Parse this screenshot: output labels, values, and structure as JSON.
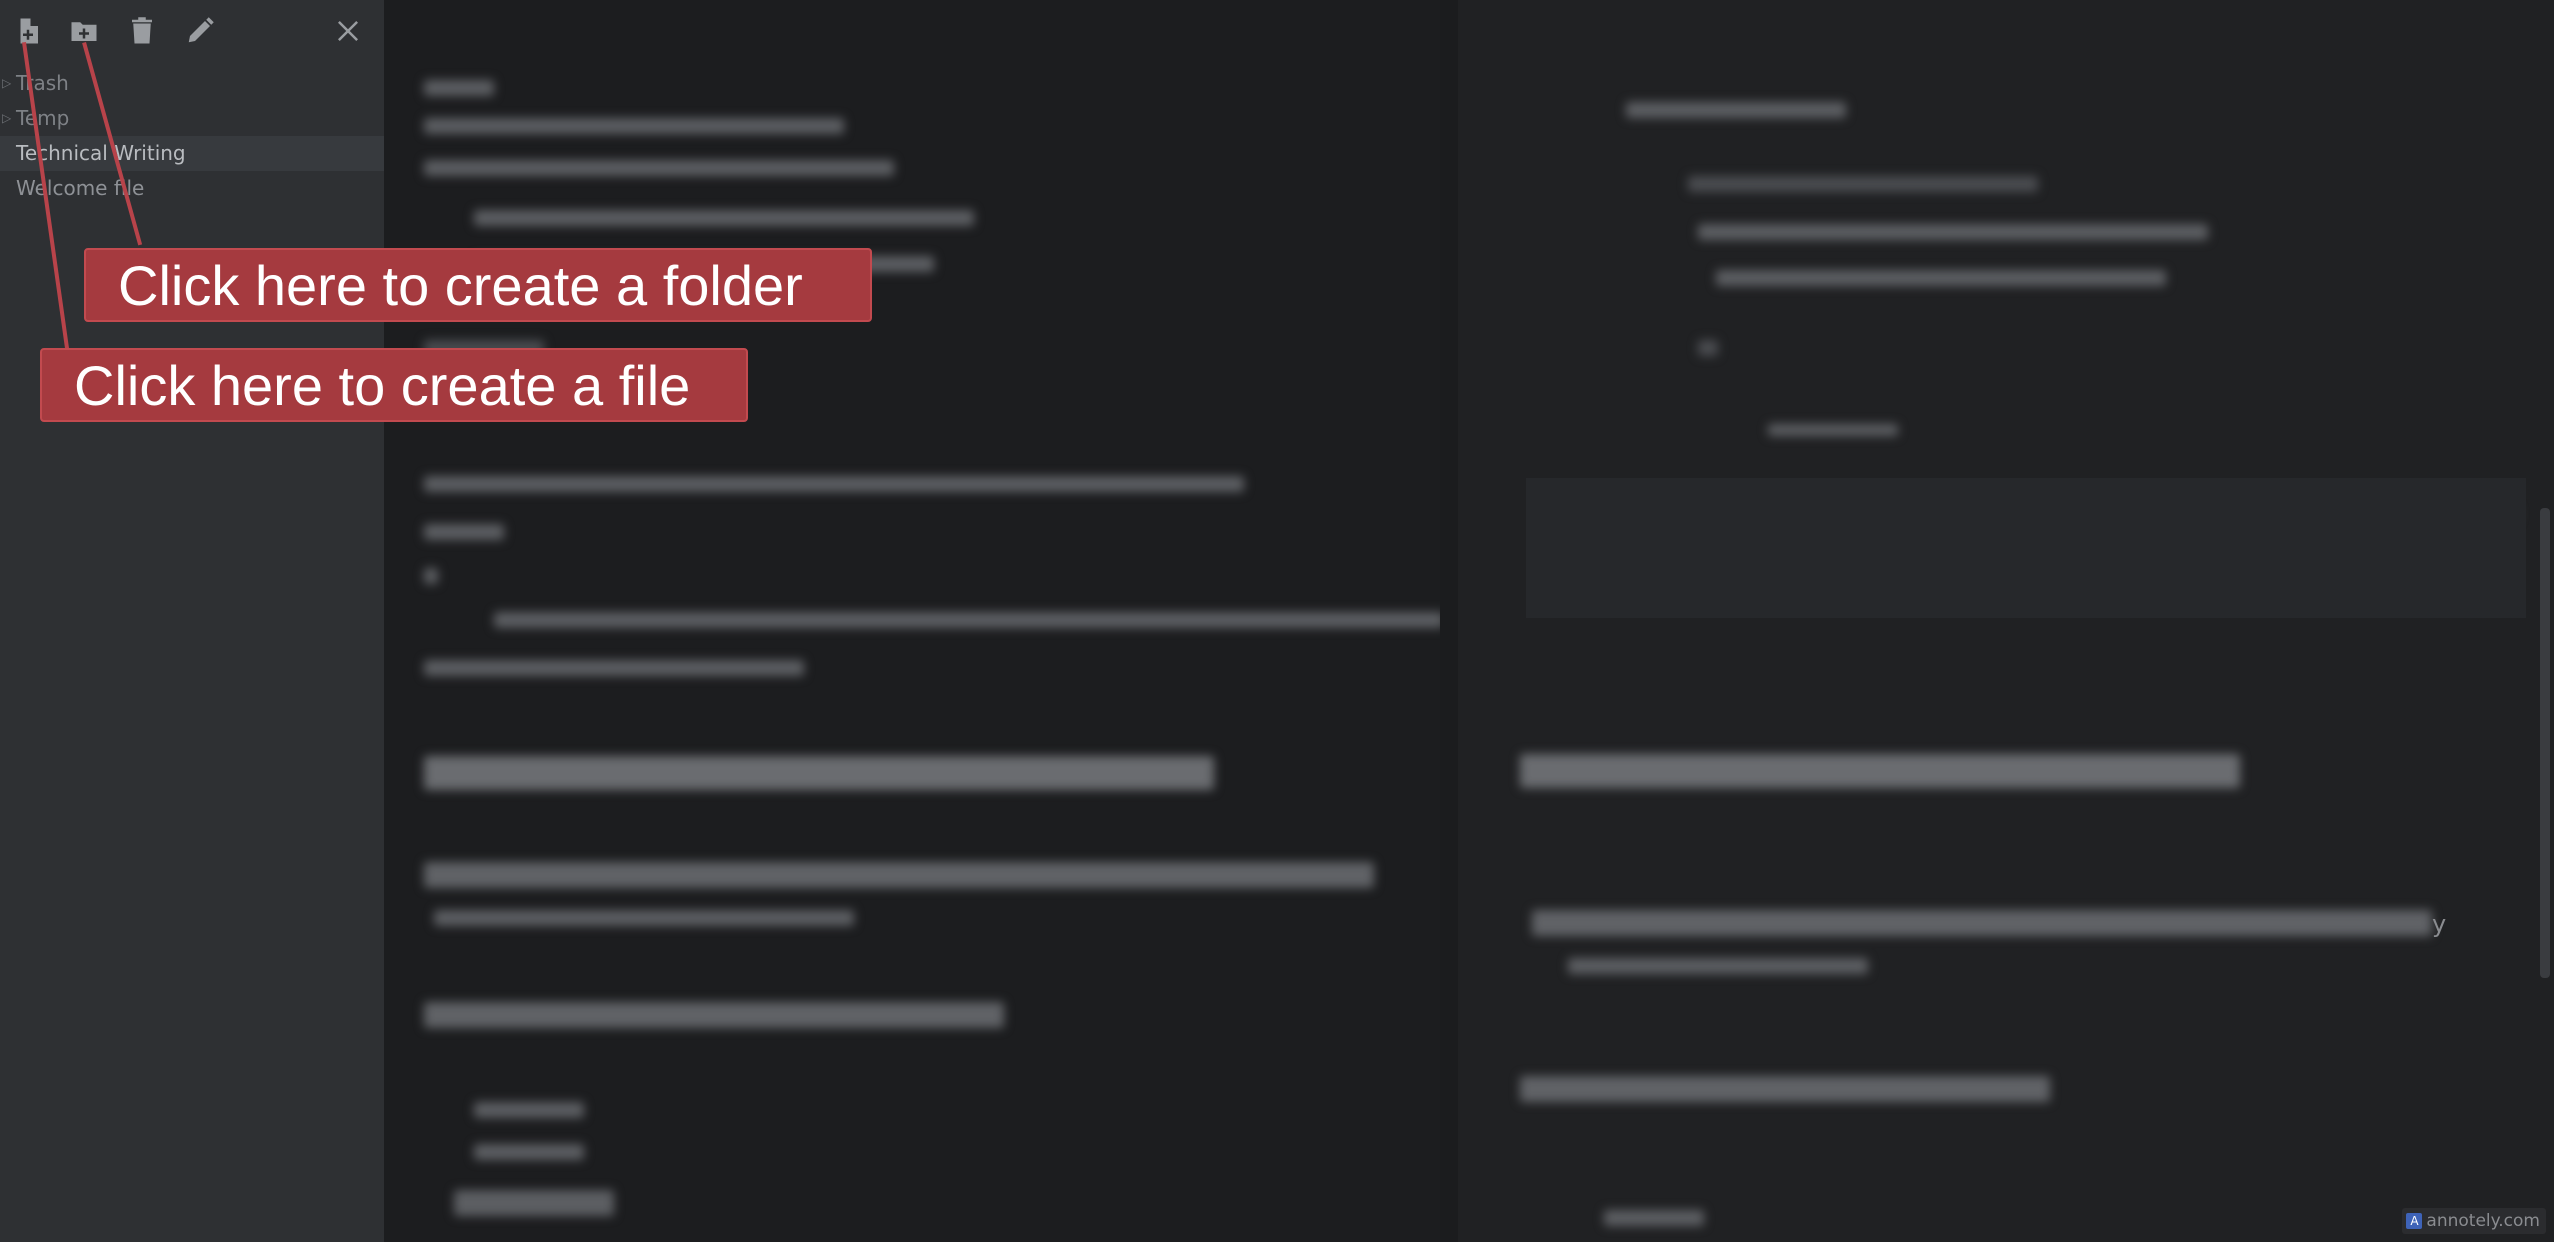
{
  "toolbar": {
    "new_file_icon": "file-plus-icon",
    "new_folder_icon": "folder-plus-icon",
    "delete_icon": "trash-icon",
    "rename_icon": "pencil-icon",
    "close_icon": "close-icon"
  },
  "tree": {
    "items": [
      {
        "label": "Trash",
        "type": "folder"
      },
      {
        "label": "Temp",
        "type": "folder"
      },
      {
        "label": "Technical Writing",
        "type": "file",
        "active": true
      },
      {
        "label": "Welcome file",
        "type": "file"
      }
    ]
  },
  "callouts": {
    "folder": "Click here to create a folder",
    "file": "Click here to create a file",
    "color": "#a53a3f"
  },
  "preview": {
    "visible_char": "y"
  },
  "watermark": {
    "logo_letter": "A",
    "text": "annotely.com"
  }
}
